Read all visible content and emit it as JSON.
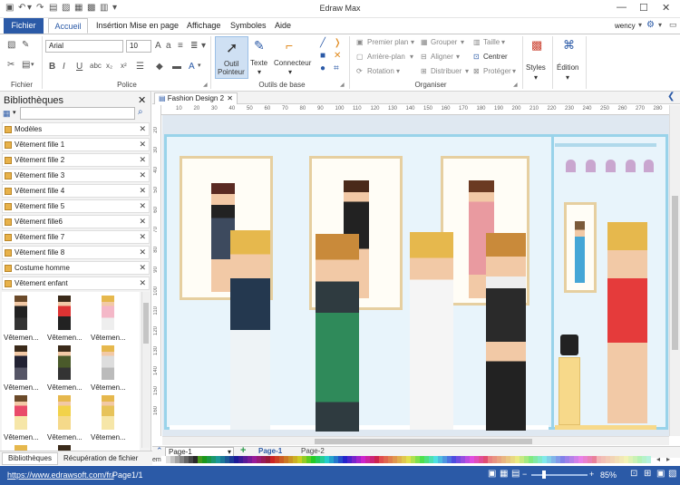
{
  "app": {
    "title": "Edraw Max",
    "user": "wency"
  },
  "menu": {
    "tabs": [
      "Fichier",
      "Accueil",
      "Insértion",
      "Mise en page",
      "Affichage",
      "Symboles",
      "Aide"
    ],
    "active": "Accueil"
  },
  "ribbon": {
    "font_name": "Arial",
    "font_size": "10",
    "group_fichier": "Fichier",
    "group_police": "Police",
    "group_outils": "Outils de base",
    "group_organiser": "Organiser",
    "outil_pointeur": "Outil Pointeur",
    "outil_label1": "Outil",
    "outil_label2": "Pointeur",
    "texte": "Texte",
    "connecteur": "Connecteur",
    "premier_plan": "Premier plan",
    "arriere_plan": "Arrière-plan",
    "rotation": "Rotation",
    "grouper": "Grouper",
    "aligner": "Aligner",
    "distribuer": "Distribuer",
    "taille": "Taille",
    "centrer": "Centrer",
    "proteger": "Protéger",
    "styles": "Styles",
    "edition": "Édition"
  },
  "library": {
    "title": "Bibliothèques",
    "search_placeholder": "",
    "items": [
      "Modèles",
      "Vêtement fille 1",
      "Vêtement fille 2",
      "Vêtement fille 3",
      "Vêtement fille 4",
      "Vêtement fille 5",
      "Vêtement fille6",
      "Vêtement fille 7",
      "Vêtement fille 8",
      "Costume homme",
      "Vêtement enfant"
    ],
    "thumb_label": "Vêtemen...",
    "tabs": [
      "Bibliothèques",
      "Récupération de fichier"
    ]
  },
  "document": {
    "tab": "Fashion Design 2",
    "ruler_h": [
      "10",
      "20",
      "30",
      "40",
      "50",
      "60",
      "70",
      "80",
      "90",
      "100",
      "110",
      "120",
      "130",
      "140",
      "150",
      "160",
      "170",
      "180",
      "190",
      "200",
      "210",
      "220",
      "230",
      "240",
      "250",
      "260",
      "270",
      "280"
    ],
    "ruler_v": [
      "20",
      "30",
      "40",
      "50",
      "60",
      "70",
      "80",
      "90",
      "100",
      "110",
      "120",
      "130",
      "140",
      "150",
      "160"
    ],
    "pages": [
      "Page-1",
      "Page-1",
      "Page-2"
    ],
    "palette_label": "emp"
  },
  "status": {
    "url": "https://www.edrawsoft.com/fr/",
    "page": "Page1/1",
    "zoom": "85%"
  },
  "colors": {
    "accent": "#2b5aa7",
    "scene_border": "#99d3ea",
    "frame": "#e6cfa0"
  }
}
